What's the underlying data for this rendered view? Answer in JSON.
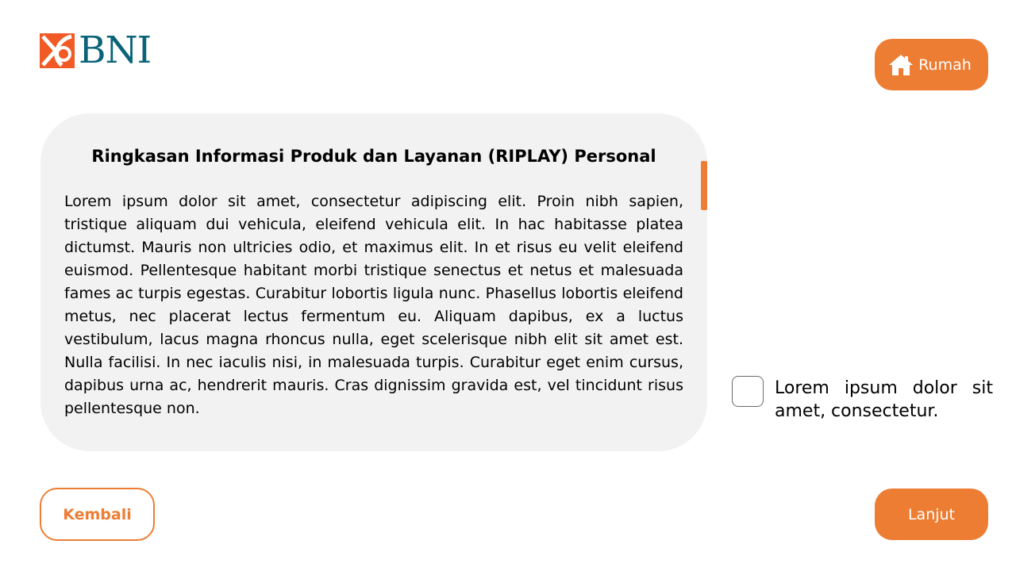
{
  "brand": {
    "logo_text": "BNI",
    "colors": {
      "accent": "#ee7d34",
      "brand_teal": "#0a6478",
      "card_bg": "#f2f2f2"
    }
  },
  "header": {
    "home_button": {
      "label": "Rumah",
      "icon": "home-icon"
    }
  },
  "content": {
    "title": "Ringkasan Informasi Produk dan Layanan (RIPLAY) Personal",
    "body": "Lorem ipsum dolor sit amet, consectetur adipiscing elit. Proin nibh sapien, tristique aliquam dui vehicula, eleifend vehicula elit. In hac habitasse platea dictumst. Mauris non ultricies odio, et maximus elit. In et risus eu velit eleifend euismod. Pellentesque habitant morbi tristique senectus et netus et malesuada fames ac turpis egestas. Curabitur lobortis ligula nunc. Phasellus lobortis eleifend metus, nec placerat lectus fermentum eu. Aliquam dapibus, ex a luctus vestibulum, lacus magna rhoncus nulla, eget scelerisque nibh elit sit amet est. Nulla facilisi. In nec iaculis nisi, in malesuada turpis. Curabitur eget enim cursus, dapibus urna ac, hendrerit mauris. Cras dignissim gravida est, vel tincidunt risus pellentesque non."
  },
  "agreement": {
    "checked": false,
    "label": "Lorem ipsum dolor sit amet, consectetur."
  },
  "footer": {
    "back_label": "Kembali",
    "next_label": "Lanjut"
  }
}
